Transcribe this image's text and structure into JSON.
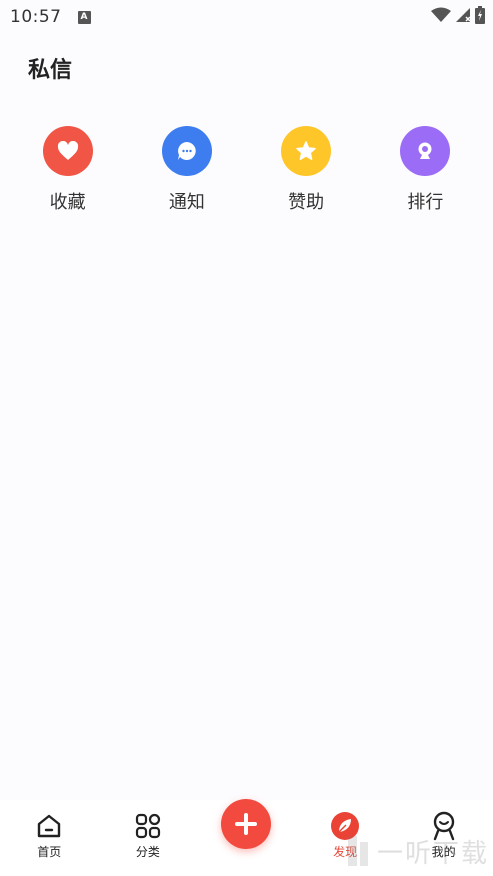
{
  "status_bar": {
    "time": "10:57",
    "notification_icon": "a-icon",
    "wifi_icon": "wifi-icon",
    "signal_icon": "signal-icon",
    "battery_icon": "battery-charging-icon"
  },
  "page": {
    "title": "私信"
  },
  "quick_actions": [
    {
      "label": "收藏",
      "icon": "heart-icon",
      "color": "#f05545"
    },
    {
      "label": "通知",
      "icon": "chat-bubble-icon",
      "color": "#3d7df0"
    },
    {
      "label": "赞助",
      "icon": "star-icon",
      "color": "#ffc62a"
    },
    {
      "label": "排行",
      "icon": "trophy-icon",
      "color": "#9b6cf5"
    }
  ],
  "bottom_nav": {
    "items": [
      {
        "label": "首页",
        "icon": "home-icon"
      },
      {
        "label": "分类",
        "icon": "grid-icon"
      },
      {
        "label": "发现",
        "icon": "leaf-icon",
        "active": true
      },
      {
        "label": "我的",
        "icon": "profile-icon"
      }
    ],
    "fab_icon": "plus-icon",
    "accent": "#f24a3f"
  },
  "watermark": {
    "text": "一听下载"
  }
}
